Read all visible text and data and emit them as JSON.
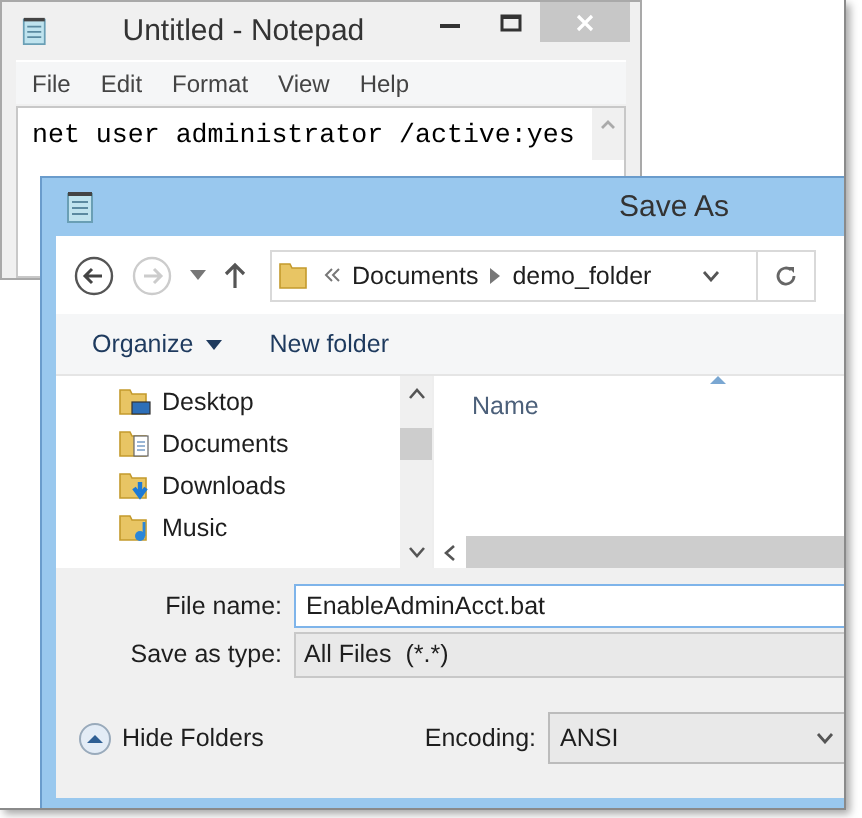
{
  "notepad": {
    "title": "Untitled - Notepad",
    "menu": [
      "File",
      "Edit",
      "Format",
      "View",
      "Help"
    ],
    "text": "net user administrator /active:yes"
  },
  "save_dialog": {
    "title": "Save As",
    "breadcrumb": [
      "Documents",
      "demo_folder"
    ],
    "toolbar": {
      "organize": "Organize",
      "new_folder": "New folder"
    },
    "tree": [
      {
        "label": "Desktop",
        "kind": "desktop"
      },
      {
        "label": "Documents",
        "kind": "documents"
      },
      {
        "label": "Downloads",
        "kind": "downloads"
      },
      {
        "label": "Music",
        "kind": "music"
      }
    ],
    "columns": [
      "Name"
    ],
    "file_name": {
      "label": "File name:",
      "value": "EnableAdminAcct.bat"
    },
    "save_as_type": {
      "label": "Save as type:",
      "value": "All Files  (*.*)"
    },
    "hide_folders": "Hide Folders",
    "encoding": {
      "label": "Encoding:",
      "value": "ANSI"
    }
  }
}
